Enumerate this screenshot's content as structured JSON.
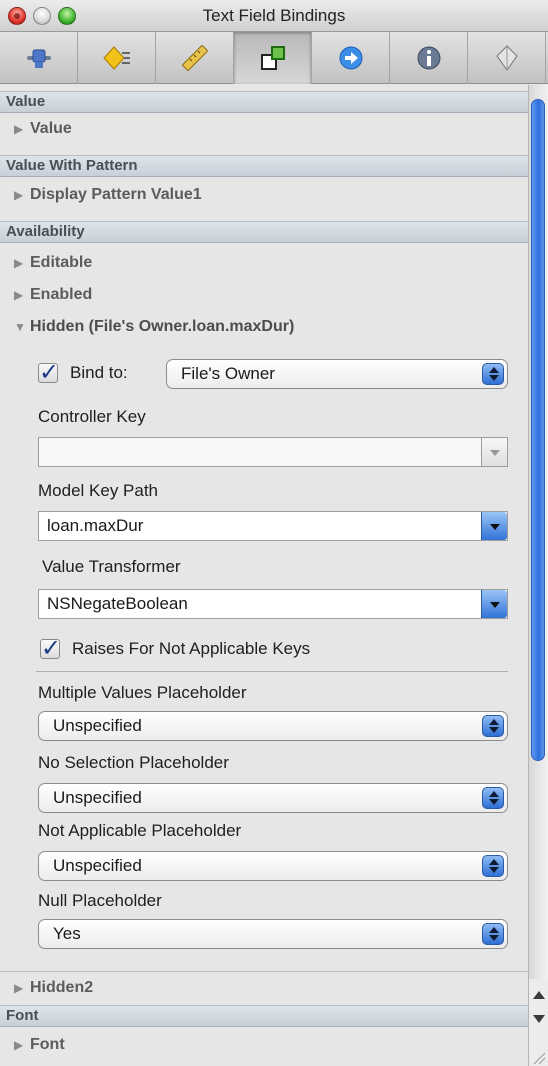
{
  "window": {
    "title": "Text Field Bindings"
  },
  "toolbar": {
    "tabs": [
      {
        "icon": "attributes-slider-icon"
      },
      {
        "icon": "effects-diamond-icon"
      },
      {
        "icon": "size-ruler-icon"
      },
      {
        "icon": "bindings-icon",
        "active": true
      },
      {
        "icon": "connections-arrow-icon"
      },
      {
        "icon": "identity-info-icon"
      },
      {
        "icon": "applescript-icon"
      }
    ]
  },
  "sections": {
    "value_header": "Value",
    "value_row": "Value",
    "pattern_header": "Value With Pattern",
    "pattern_row": "Display Pattern Value1",
    "availability_header": "Availability",
    "editable_row": "Editable",
    "enabled_row": "Enabled",
    "hidden_row": "Hidden (File's Owner.loan.maxDur)",
    "hidden2_row": "Hidden2",
    "font_header": "Font",
    "font_row": "Font"
  },
  "binding": {
    "bind_to_label": "Bind to:",
    "bind_to_checked": true,
    "bind_to_value": "File's Owner",
    "controller_key_label": "Controller Key",
    "controller_key_value": "",
    "model_key_path_label": "Model Key Path",
    "model_key_path_value": "loan.maxDur",
    "value_transformer_label": "Value Transformer",
    "value_transformer_value": "NSNegateBoolean",
    "raises_label": "Raises For Not Applicable Keys",
    "raises_checked": true,
    "multiple_values_label": "Multiple Values Placeholder",
    "multiple_values_value": "Unspecified",
    "no_selection_label": "No Selection Placeholder",
    "no_selection_value": "Unspecified",
    "not_applicable_label": "Not Applicable Placeholder",
    "not_applicable_value": "Unspecified",
    "null_label": "Null Placeholder",
    "null_value": "Yes"
  },
  "colors": {
    "accent": "#2f6fd3",
    "section_header": "#c8cfd8"
  }
}
